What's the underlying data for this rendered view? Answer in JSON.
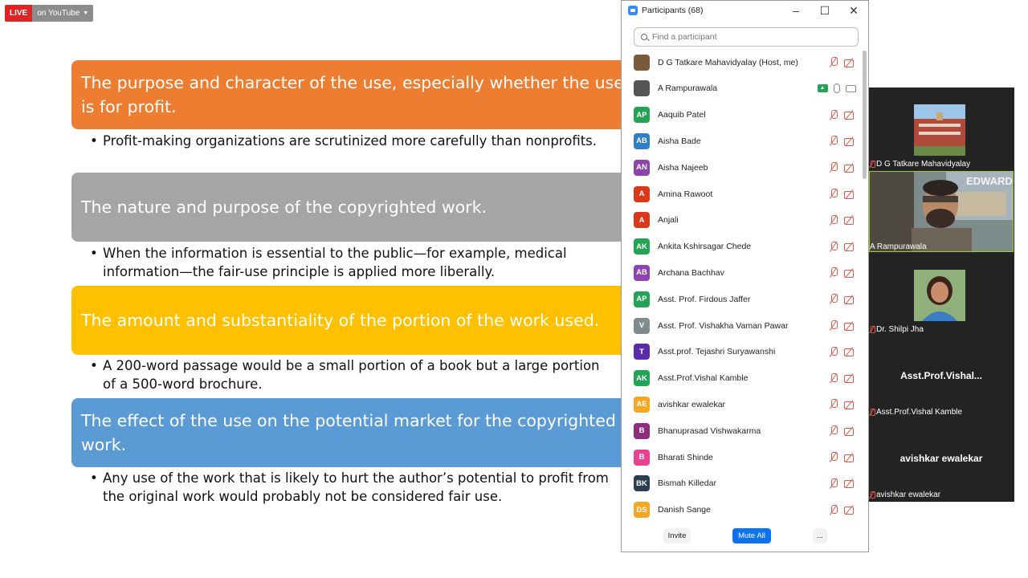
{
  "live_badge": {
    "live": "LIVE",
    "platform": "on YouTube"
  },
  "slide": {
    "items": [
      {
        "heading": "The purpose and character of the use, especially whether the use is for profit.",
        "bullet": "Profit-making organizations are scrutinized more carefully than nonprofits.",
        "color": "#ed7d31"
      },
      {
        "heading": "The nature and purpose of the copyrighted work.",
        "bullet": "When the information is essential to the public—for example, medical information—the fair-use principle is applied more liberally.",
        "color": "#a5a5a5"
      },
      {
        "heading": "The amount and substantiality of the portion of the work used.",
        "bullet": "A 200-word passage would be a small portion of a book but a large portion of a 500-word brochure.",
        "color": "#ffc000"
      },
      {
        "heading": "The effect of the use on the potential market for the copyrighted work.",
        "bullet": "Any use of the work that is likely to hurt the author’s potential to profit from the original work would probably not be considered fair use.",
        "color": "#5b9bd5"
      }
    ]
  },
  "participants_panel": {
    "title": "Participants (68)",
    "search_placeholder": "Find a participant",
    "participants": [
      {
        "name": "D G Tatkare Mahavidyalay (Host, me)",
        "avatar": "",
        "color": "#7a5a3a",
        "state": "muted"
      },
      {
        "name": "A Rampurawala",
        "avatar": "",
        "color": "#555555",
        "state": "active"
      },
      {
        "name": "Aaquib Patel",
        "avatar": "AP",
        "color": "#23a455",
        "state": "muted"
      },
      {
        "name": "Aisha Bade",
        "avatar": "AB",
        "color": "#2f7fc1",
        "state": "muted"
      },
      {
        "name": "Aisha Najeeb",
        "avatar": "AN",
        "color": "#8e44ad",
        "state": "muted"
      },
      {
        "name": "Amina Rawoot",
        "avatar": "A",
        "color": "#d9391a",
        "state": "muted"
      },
      {
        "name": "Anjali",
        "avatar": "A",
        "color": "#d9391a",
        "state": "muted"
      },
      {
        "name": "Ankita Kshirsagar Chede",
        "avatar": "AK",
        "color": "#23a455",
        "state": "muted"
      },
      {
        "name": "Archana Bachhav",
        "avatar": "AB",
        "color": "#8e44ad",
        "state": "muted"
      },
      {
        "name": "Asst. Prof. Firdous Jaffer",
        "avatar": "AP",
        "color": "#23a455",
        "state": "muted"
      },
      {
        "name": "Asst. Prof. Vishakha Vaman Pawar",
        "avatar": "V",
        "color": "#7f8c8d",
        "state": "muted"
      },
      {
        "name": "Asst.prof. Tejashri Suryawanshi",
        "avatar": "T",
        "color": "#5b2ca8",
        "state": "muted"
      },
      {
        "name": "Asst.Prof.Vishal Kamble",
        "avatar": "AK",
        "color": "#23a455",
        "state": "muted"
      },
      {
        "name": "avishkar ewalekar",
        "avatar": "AE",
        "color": "#f5a623",
        "state": "muted"
      },
      {
        "name": "Bhanuprasad Vishwakarma",
        "avatar": "B",
        "color": "#8e2c7e",
        "state": "muted"
      },
      {
        "name": "Bharati Shinde",
        "avatar": "B",
        "color": "#e84393",
        "state": "muted"
      },
      {
        "name": "Bismah Killedar",
        "avatar": "BK",
        "color": "#2c3e50",
        "state": "muted"
      },
      {
        "name": "Danish Sange",
        "avatar": "DS",
        "color": "#f5a623",
        "state": "muted"
      }
    ],
    "footer": {
      "invite": "Invite",
      "mute_all": "Mute All",
      "more": "..."
    }
  },
  "gallery": {
    "tiles": [
      {
        "label": "D G Tatkare Mahavidyalay",
        "type": "photo-college",
        "muted": true
      },
      {
        "label": "A Rampurawala",
        "type": "camera",
        "muted": false
      },
      {
        "label": "Dr. Shilpi Jha",
        "type": "photo-person",
        "muted": true
      },
      {
        "label": "Asst.Prof.Vishal Kamble",
        "big": "Asst.Prof.Vishal...",
        "type": "name",
        "muted": true
      },
      {
        "label": "avishkar ewalekar",
        "big": "avishkar ewalekar",
        "type": "name",
        "muted": true
      }
    ]
  }
}
